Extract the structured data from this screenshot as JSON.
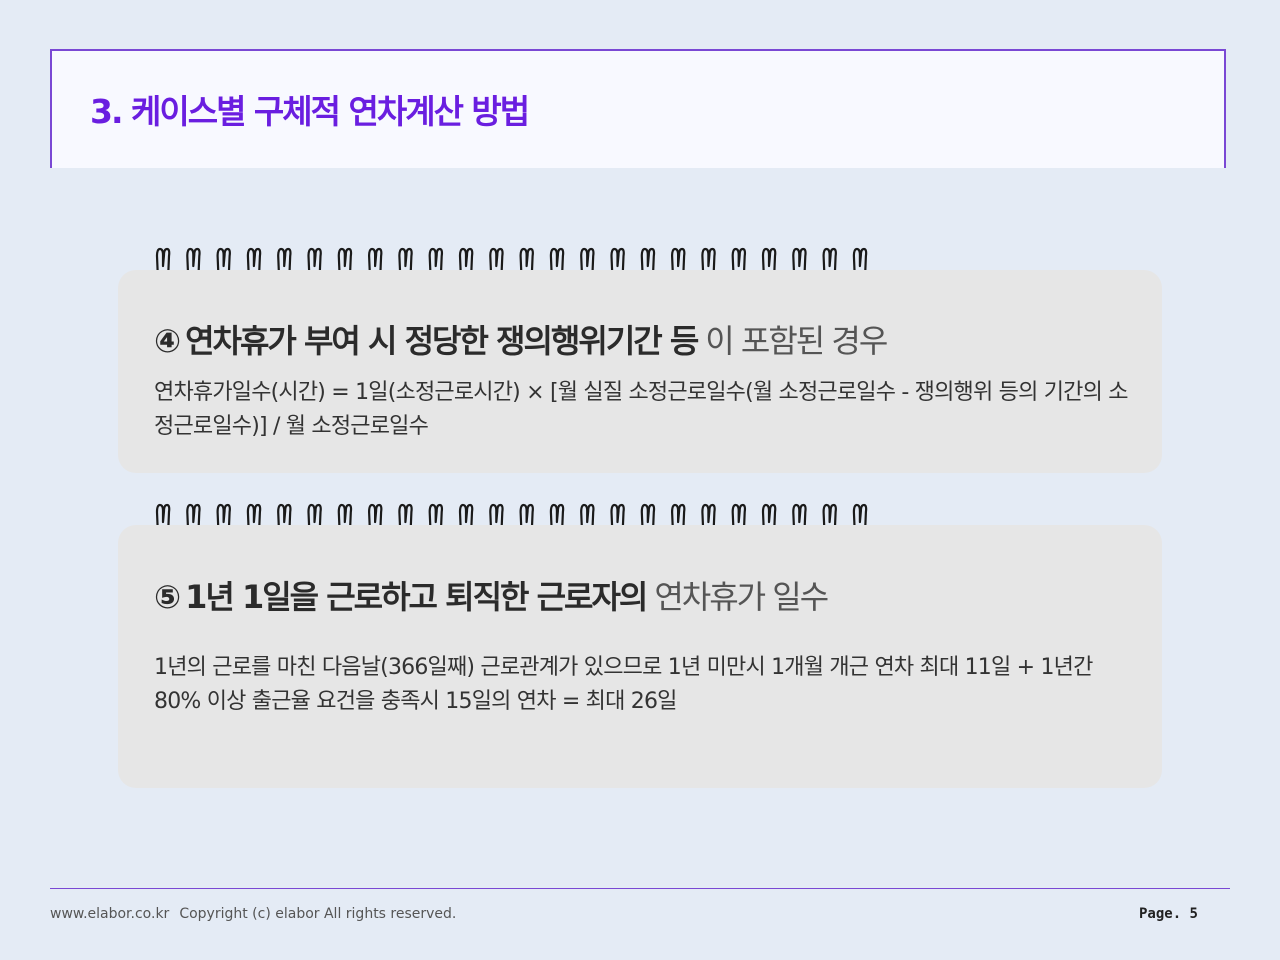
{
  "header": {
    "title": "3. 케이스별 구체적 연차계산 방법"
  },
  "cards": [
    {
      "num": "④",
      "heading_bold": "연차휴가 부여 시 정당한 쟁의행위기간 등",
      "heading_light": "이 포함된 경우",
      "body": "연차휴가일수(시간) = 1일(소정근로시간) × [월 실질 소정근로일수(월 소정근로일수 - 쟁의행위 등의 기간의 소정근로일수)] / 월 소정근로일수"
    },
    {
      "num": "⑤",
      "heading_bold": "1년 1일을 근로하고 퇴직한 근로자의",
      "heading_light": "연차휴가 일수",
      "body": "1년의 근로를 마친 다음날(366일째) 근로관계가 있으므로 1년 미만시 1개월 개근 연차 최대 11일 + 1년간 80% 이상 출근율 요건을 충족시 15일의 연차 = 최대 26일"
    }
  ],
  "footer": {
    "site": "www.elabor.co.kr",
    "copyright": "Copyright (c) elabor All rights reserved.",
    "page": "Page. 5"
  },
  "colors": {
    "accent": "#7a48d4",
    "title": "#6a1ee0",
    "background": "#e4ebf5",
    "card": "#e6e6e6"
  },
  "decorations": {
    "binder_ring": "spiral-ring-icon"
  }
}
